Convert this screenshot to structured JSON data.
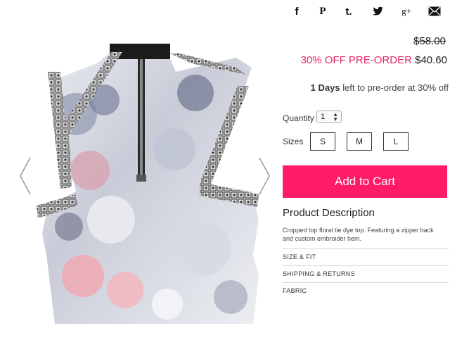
{
  "share": {
    "icons": [
      "facebook-icon",
      "pinterest-icon",
      "tumblr-icon",
      "twitter-icon",
      "google-plus-icon",
      "email-icon"
    ],
    "facebook": "f",
    "pinterest": "P",
    "tumblr": "t.",
    "google_plus": "g+"
  },
  "price": {
    "original": "$58.00",
    "promo": "30% OFF PRE-ORDER",
    "sale": "$40.60"
  },
  "preorder": {
    "days": "1 Days",
    "rest": " left to pre-order at 30% off"
  },
  "quantity": {
    "label": "Quantity",
    "value": "1"
  },
  "sizes": {
    "label": "Sizes",
    "options": [
      "S",
      "M",
      "L"
    ]
  },
  "cart": {
    "label": "Add to Cart"
  },
  "description": {
    "title": "Product Description",
    "text": "Cropped top floral tie dye top. Featuring a zipper back and custom embroider hem."
  },
  "accordion": [
    "SIZE & FIT",
    "SHIPPING & RETURNS",
    "FABRIC"
  ],
  "colors": {
    "accent": "#ff1a6a",
    "promo_text": "#e8246d"
  }
}
